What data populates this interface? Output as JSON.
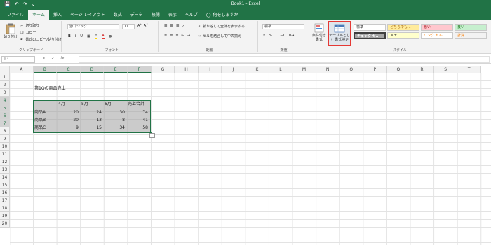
{
  "titlebar": {
    "title": "Book1 - Excel",
    "color": "#217346"
  },
  "qat": {
    "save": "💾",
    "undo": "↶",
    "redo": "↷",
    "more": "⌄"
  },
  "tabs": [
    "ファイル",
    "ホーム",
    "挿入",
    "ページ レイアウト",
    "数式",
    "データ",
    "校閲",
    "表示",
    "ヘルプ"
  ],
  "tell_me": "何をしますか",
  "ribbon": {
    "clipboard": {
      "paste": "貼り付け",
      "cut": "切り取り",
      "copy": "コピー",
      "format_painter": "書式のコピー/貼り付け",
      "label": "クリップボード"
    },
    "font": {
      "name": "游ゴシック",
      "size": "11",
      "grow": "A˄",
      "shrink": "A˅",
      "bold": "B",
      "italic": "I",
      "underline": "U",
      "color_a": "A",
      "label": "フォント"
    },
    "alignment": {
      "wrap": "折り返して全体を表示する",
      "merge": "セルを結合して中央揃え",
      "label": "配置"
    },
    "number": {
      "format": "標準",
      "percent": "%",
      "comma": ",",
      "label": "数値"
    },
    "styles": {
      "conditional": "条件付き 書式",
      "as_table": "テーブルとして 書式設定",
      "cells": [
        "標準",
        "どちらでも...",
        "悪い",
        "良い",
        "チェック セ...",
        "メモ",
        "リンク セル",
        "計算"
      ],
      "label": "スタイル"
    }
  },
  "formula_bar": {
    "name_box": "B4",
    "cancel": "×",
    "enter": "✓",
    "fx": "fx",
    "value": ""
  },
  "grid": {
    "columns": [
      "A",
      "B",
      "C",
      "D",
      "E",
      "F",
      "G",
      "H",
      "I",
      "J",
      "K",
      "L",
      "M",
      "N",
      "O",
      "P",
      "Q",
      "R",
      "S",
      "T"
    ],
    "rows": [
      "1",
      "2",
      "3",
      "4",
      "5",
      "6",
      "7",
      "8",
      "9",
      "10",
      "11",
      "12",
      "13",
      "14",
      "15",
      "16",
      "17",
      "18",
      "19",
      "20"
    ],
    "title_cell": "第1Qの商品売上",
    "headers": [
      "4月",
      "5月",
      "6月",
      "売上合計"
    ],
    "table": [
      {
        "name": "商品A",
        "values": [
          "20",
          "24",
          "30",
          "74"
        ]
      },
      {
        "name": "商品B",
        "values": [
          "20",
          "13",
          "8",
          "41"
        ]
      },
      {
        "name": "商品C",
        "values": [
          "9",
          "15",
          "34",
          "58"
        ]
      }
    ]
  }
}
